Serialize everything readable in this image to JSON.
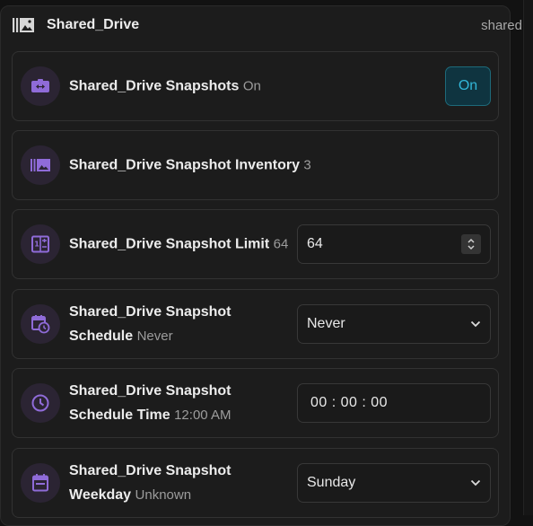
{
  "panel": {
    "title": "Shared_Drive",
    "tag": "shared"
  },
  "rows": [
    {
      "label": "Shared_Drive Snapshots",
      "value": "On",
      "control": "toggle",
      "control_value": "On",
      "icon": "toggle-switch-icon"
    },
    {
      "label": "Shared_Drive Snapshot Inventory",
      "value": "3",
      "icon": "image-library-icon"
    },
    {
      "label": "Shared_Drive Snapshot Limit",
      "value": "64",
      "control": "number",
      "control_value": "64",
      "icon": "counter-icon"
    },
    {
      "label_line1": "Shared_Drive Snapshot",
      "label_line2": "Schedule",
      "value": "Never",
      "control": "select",
      "control_value": "Never",
      "icon": "calendar-clock-icon"
    },
    {
      "label_line1": "Shared_Drive Snapshot",
      "label_line2": "Schedule Time",
      "value": "12:00 AM",
      "control": "time",
      "control_value": "00 : 00 : 00",
      "icon": "clock-icon"
    },
    {
      "label_line1": "Shared_Drive Snapshot",
      "label_line2": "Weekday",
      "value": "Unknown",
      "control": "select",
      "control_value": "Sunday",
      "icon": "calendar-icon"
    }
  ],
  "colors": {
    "accent_purple": "#8f6bd8",
    "accent_cyan": "#32b6d8",
    "background": "#1c1c1c"
  }
}
